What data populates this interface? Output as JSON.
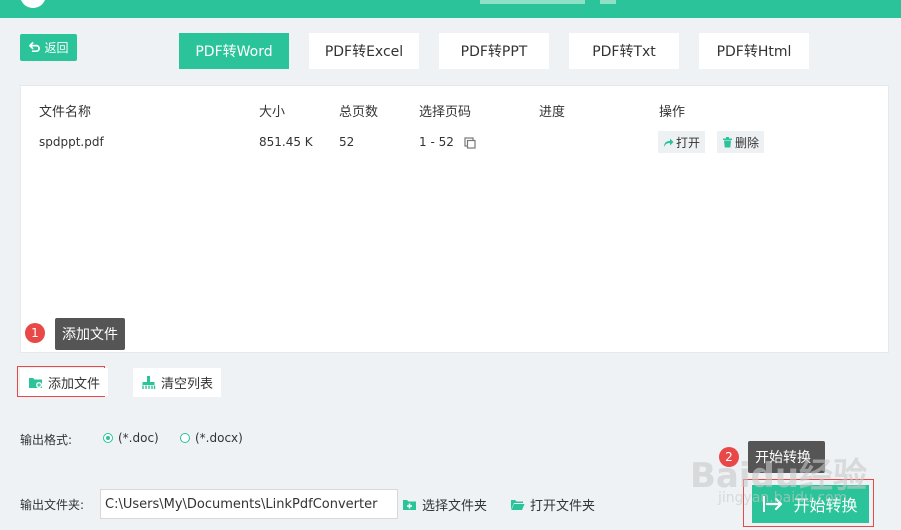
{
  "header": {
    "back_label": "返回"
  },
  "tabs": [
    {
      "label": "PDF转Word",
      "active": true
    },
    {
      "label": "PDF转Excel",
      "active": false
    },
    {
      "label": "PDF转PPT",
      "active": false
    },
    {
      "label": "PDF转Txt",
      "active": false
    },
    {
      "label": "PDF转Html",
      "active": false
    }
  ],
  "table": {
    "columns": [
      "文件名称",
      "大小",
      "总页数",
      "选择页码",
      "进度",
      "操作"
    ],
    "rows": [
      {
        "name": "spdppt.pdf",
        "size": "851.45 K",
        "pages": "52",
        "range": "1 - 52",
        "progress": ""
      }
    ],
    "actions": {
      "open": "打开",
      "delete": "删除"
    }
  },
  "annotations": {
    "tip1": {
      "badge": "1",
      "text": "添加文件"
    },
    "tip2": {
      "badge": "2",
      "text": "开始转换"
    }
  },
  "toolbar": {
    "add_file": "添加文件",
    "clear_list": "清空列表"
  },
  "output": {
    "format_label": "输出格式:",
    "formats": [
      {
        "label": "(*.doc)",
        "selected": true
      },
      {
        "label": "(*.docx)",
        "selected": false
      }
    ],
    "folder_label": "输出文件夹:",
    "folder_path": "C:\\Users\\My\\Documents\\LinkPdfConverter",
    "choose_folder": "选择文件夹",
    "open_folder": "打开文件夹"
  },
  "start_label": "开始转换",
  "watermark": {
    "logo": "Baidu经验",
    "url": "jingyan.baidu.com"
  },
  "colors": {
    "accent": "#2bc49a",
    "badge": "#e84848",
    "tooltip": "#555555"
  }
}
